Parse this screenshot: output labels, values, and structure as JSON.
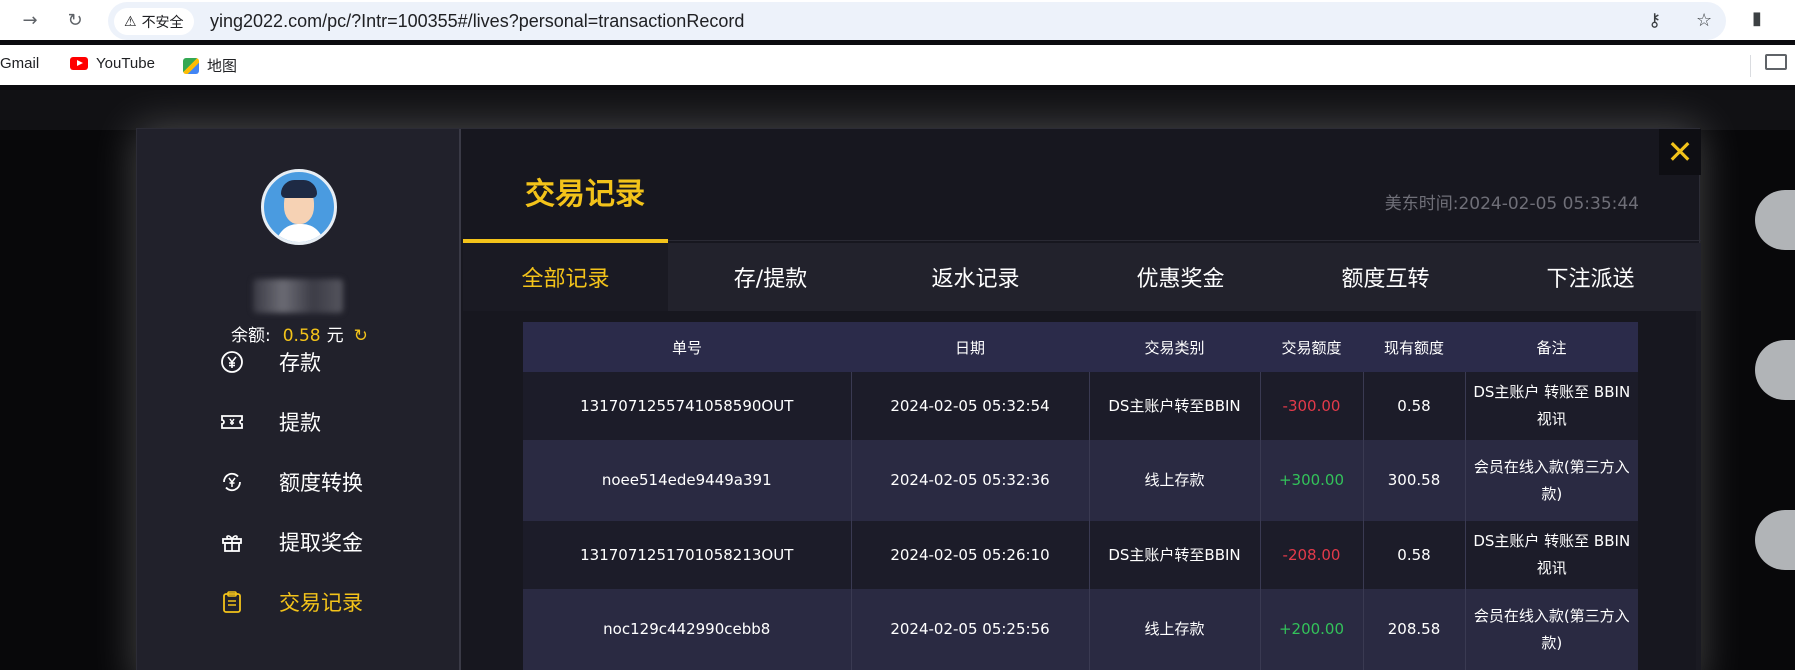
{
  "browser": {
    "security_label": "不安全",
    "url": "ying2022.com/pc/?Intr=100355#/lives?personal=transactionRecord",
    "bookmarks": [
      {
        "label": "Gmail"
      },
      {
        "label": "YouTube"
      },
      {
        "label": "地图"
      }
    ]
  },
  "sidebar": {
    "balance_label": "余额:",
    "balance_value": "0.58",
    "balance_unit": "元",
    "menu": [
      {
        "label": "存款",
        "icon": "yen-circle-icon"
      },
      {
        "label": "提款",
        "icon": "ticket-icon"
      },
      {
        "label": "额度转换",
        "icon": "yen-exchange-icon"
      },
      {
        "label": "提取奖金",
        "icon": "gift-icon"
      },
      {
        "label": "交易记录",
        "icon": "clipboard-icon",
        "active": true
      }
    ]
  },
  "main": {
    "title": "交易记录",
    "time": "美东时间:2024-02-05 05:35:44",
    "close_symbol": "✕",
    "tabs": [
      {
        "label": "全部记录",
        "active": true
      },
      {
        "label": "存/提款"
      },
      {
        "label": "返水记录"
      },
      {
        "label": "优惠奖金"
      },
      {
        "label": "额度互转"
      },
      {
        "label": "下注派送"
      }
    ]
  },
  "table": {
    "headers": [
      "单号",
      "日期",
      "交易类别",
      "交易额度",
      "现有额度",
      "备注"
    ],
    "rows": [
      {
        "id": "1317071255741058590OUT",
        "date": "2024-02-05 05:32:54",
        "type": "DS主账户转至BBIN",
        "amount": "-300.00",
        "sign": "neg",
        "balance": "0.58",
        "note": "DS主账户 转账至 BBIN视讯"
      },
      {
        "id": "noee514ede9449a391",
        "date": "2024-02-05 05:32:36",
        "type": "线上存款",
        "amount": "+300.00",
        "sign": "pos",
        "balance": "300.58",
        "note": "会员在线入款(第三方入款)"
      },
      {
        "id": "1317071251701058213OUT",
        "date": "2024-02-05 05:26:10",
        "type": "DS主账户转至BBIN",
        "amount": "-208.00",
        "sign": "neg",
        "balance": "0.58",
        "note": "DS主账户 转账至 BBIN视讯"
      },
      {
        "id": "noc129c442990cebb8",
        "date": "2024-02-05 05:25:56",
        "type": "线上存款",
        "amount": "+200.00",
        "sign": "pos",
        "balance": "208.58",
        "note": "会员在线入款(第三方入款)"
      }
    ]
  }
}
